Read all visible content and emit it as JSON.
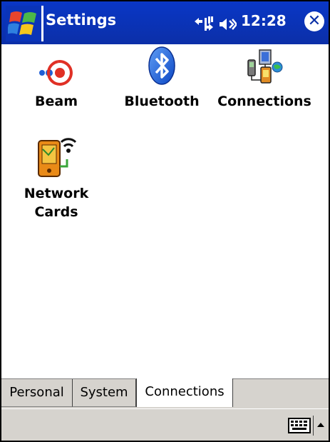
{
  "titlebar": {
    "title": "Settings",
    "clock": "12:28",
    "close_glyph": "✕",
    "bg_color": "#0a37c6"
  },
  "apps": [
    {
      "label": "Beam",
      "icon": "beam-icon"
    },
    {
      "label": "Bluetooth",
      "icon": "bluetooth-icon"
    },
    {
      "label": "Connections",
      "icon": "connections-icon"
    },
    {
      "label_line1": "Network",
      "label_line2": "Cards",
      "icon": "network-cards-icon"
    }
  ],
  "tabs": [
    {
      "label": "Personal",
      "active": false
    },
    {
      "label": "System",
      "active": false
    },
    {
      "label": "Connections",
      "active": true
    }
  ],
  "menubar": {
    "sip_icon": "keyboard-icon",
    "sip_arrow_icon": "up-arrow-icon"
  }
}
